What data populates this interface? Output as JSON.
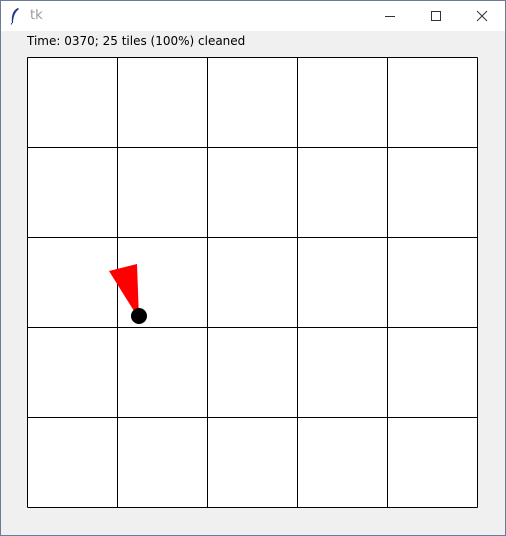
{
  "window": {
    "title": "tk",
    "minimize_icon": "minimize-icon",
    "maximize_icon": "maximize-icon",
    "close_icon": "close-icon",
    "app_icon": "feather-icon"
  },
  "status": {
    "text": "Time: 0370; 25 tiles (100%) cleaned"
  },
  "simulation": {
    "grid_columns": 5,
    "grid_rows": 5,
    "tiles_cleaned": 25,
    "percent_cleaned": 100,
    "time": "0370",
    "robot_color": "#000000",
    "direction_marker_color": "#ff0000",
    "tile_color": "#ffffff",
    "grid_line_color": "#000000"
  }
}
